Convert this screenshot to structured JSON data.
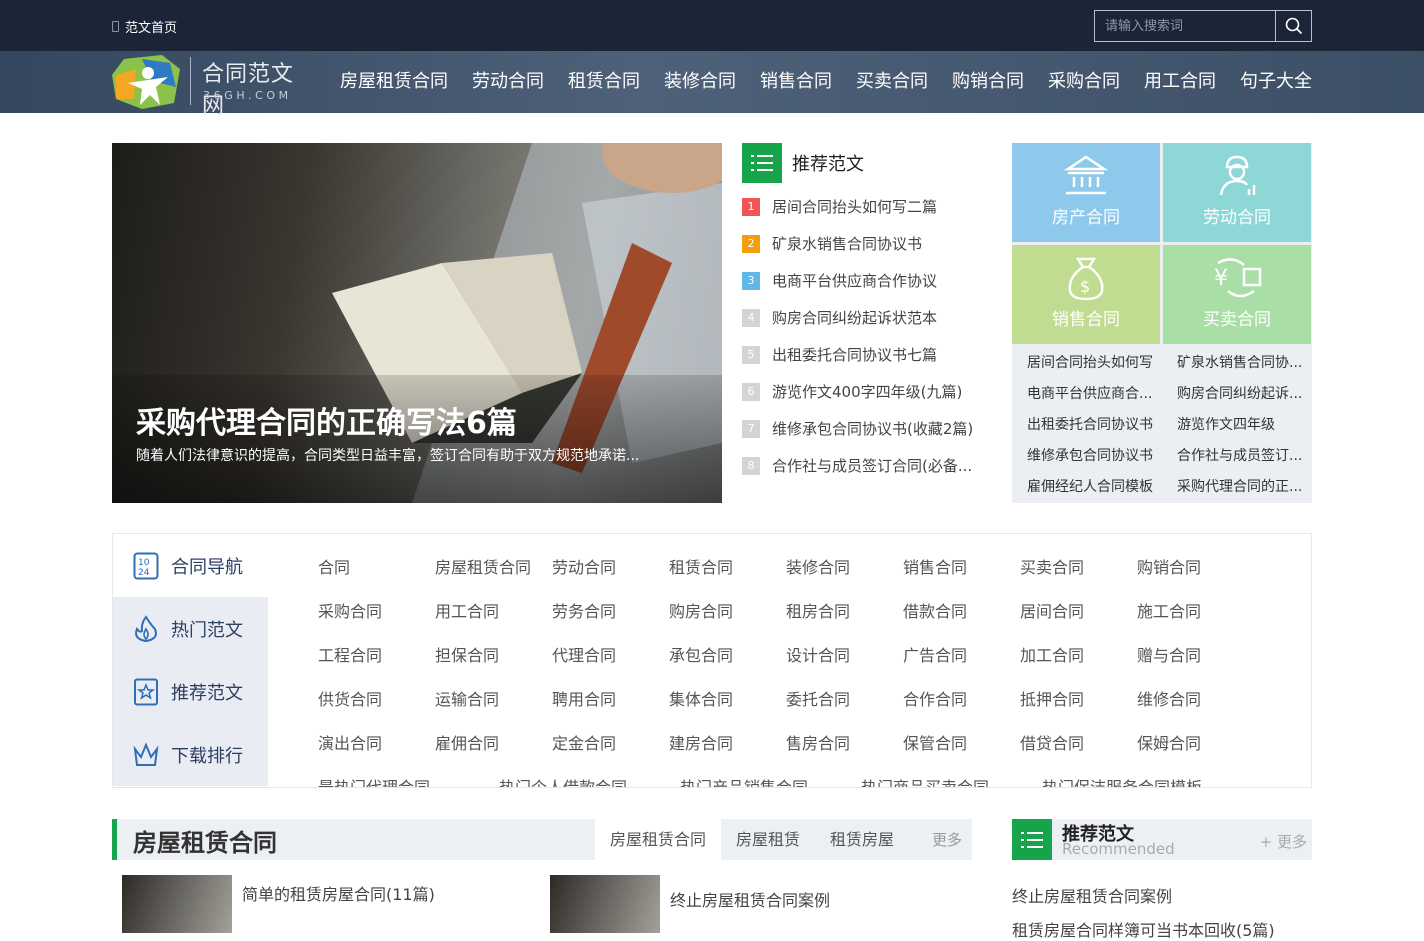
{
  "topbar": {
    "home_label": "范文首页",
    "search_placeholder": "请输入搜索词"
  },
  "logo": {
    "name": "合同范文网",
    "domain": "36GH.COM"
  },
  "nav": [
    "房屋租赁合同",
    "劳动合同",
    "租赁合同",
    "装修合同",
    "销售合同",
    "买卖合同",
    "购销合同",
    "采购合同",
    "用工合同",
    "句子大全"
  ],
  "hero": {
    "title": "采购代理合同的正确写法6篇",
    "desc": "随着人们法律意识的提高，合同类型日益丰富，签订合同有助于双方规范地承诺..."
  },
  "recommend": {
    "title": "推荐范文",
    "items": [
      {
        "num": "1",
        "text": "居间合同抬头如何写二篇",
        "color": "#f05454"
      },
      {
        "num": "2",
        "text": "矿泉水销售合同协议书",
        "color": "#f59e0b"
      },
      {
        "num": "3",
        "text": "电商平台供应商合作协议",
        "color": "#60b8e8"
      },
      {
        "num": "4",
        "text": "购房合同纠纷起诉状范本",
        "color": "#d4d4d4"
      },
      {
        "num": "5",
        "text": "出租委托合同协议书七篇",
        "color": "#d4d4d4"
      },
      {
        "num": "6",
        "text": "游览作文400字四年级(九篇)",
        "color": "#d4d4d4"
      },
      {
        "num": "7",
        "text": "维修承包合同协议书(收藏2篇)",
        "color": "#d4d4d4"
      },
      {
        "num": "8",
        "text": "合作社与成员签订合同(必备...",
        "color": "#d4d4d4"
      }
    ]
  },
  "tiles": [
    {
      "label": "房产合同",
      "color": "#8ec9ec",
      "icon": "bank-icon"
    },
    {
      "label": "劳动合同",
      "color": "#8dd8d6",
      "icon": "worker-icon"
    },
    {
      "label": "销售合同",
      "color": "#bfdc90",
      "icon": "money-bag-icon"
    },
    {
      "label": "买卖合同",
      "color": "#a9dea6",
      "icon": "exchange-icon"
    }
  ],
  "tile_links": [
    [
      "居间合同抬头如何写",
      "矿泉水销售合同协..."
    ],
    [
      "电商平台供应商合...",
      "购房合同纠纷起诉..."
    ],
    [
      "出租委托合同协议书",
      "游览作文四年级"
    ],
    [
      "维修承包合同协议书",
      "合作社与成员签订..."
    ],
    [
      "雇佣经纪人合同模板",
      "采购代理合同的正..."
    ]
  ],
  "side_nav": [
    "合同导航",
    "热门范文",
    "推荐范文",
    "下载排行"
  ],
  "contract_grid": [
    [
      "合同",
      "房屋租赁合同",
      "劳动合同",
      "租赁合同",
      "装修合同",
      "销售合同",
      "买卖合同",
      "购销合同"
    ],
    [
      "采购合同",
      "用工合同",
      "劳务合同",
      "购房合同",
      "租房合同",
      "借款合同",
      "居间合同",
      "施工合同"
    ],
    [
      "工程合同",
      "担保合同",
      "代理合同",
      "承包合同",
      "设计合同",
      "广告合同",
      "加工合同",
      "赠与合同"
    ],
    [
      "供货合同",
      "运输合同",
      "聘用合同",
      "集体合同",
      "委托合同",
      "合作合同",
      "抵押合同",
      "维修合同"
    ],
    [
      "演出合同",
      "雇佣合同",
      "定金合同",
      "建房合同",
      "售房合同",
      "保管合同",
      "借贷合同",
      "保姆合同"
    ]
  ],
  "hot_row": [
    "最热门代理合同",
    "热门个人借款合同",
    "热门产品销售合同",
    "热门商品买卖合同",
    "热门保洁服务合同模板"
  ],
  "section": {
    "title": "房屋租赁合同",
    "tabs": [
      "房屋租赁合同",
      "房屋租赁",
      "租赁房屋"
    ],
    "more": "更多"
  },
  "articles": [
    {
      "title": "简单的租赁房屋合同(11篇)"
    },
    {
      "title": "终止房屋租赁合同案例"
    }
  ],
  "rec_panel": {
    "title": "推荐范文",
    "subtitle": "Recommended",
    "more": "+ 更多",
    "items": [
      "终止房屋租赁合同案例",
      "租赁房屋合同样簿可当书本回收(5篇)"
    ]
  },
  "colors": {
    "accent": "#16a34a",
    "topbar": "#1b2537"
  }
}
